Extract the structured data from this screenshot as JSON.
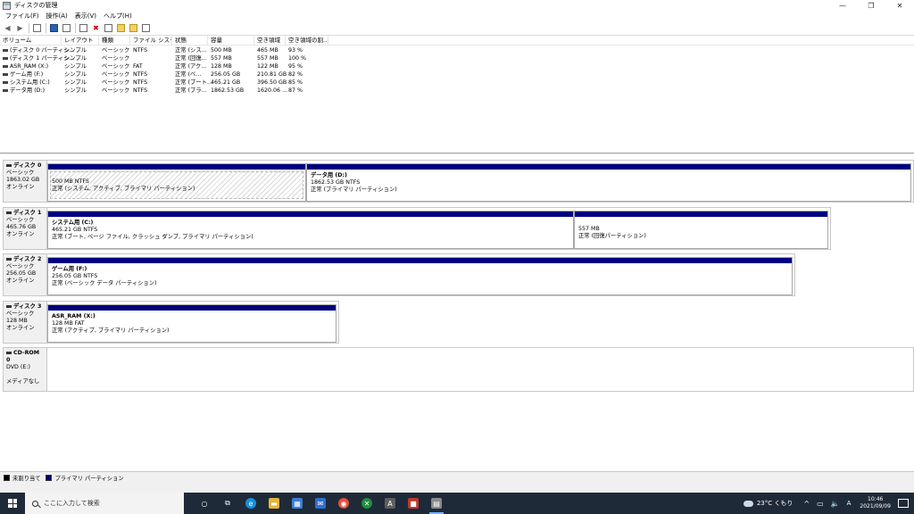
{
  "window": {
    "title": "ディスクの管理",
    "minimize_glyph": "—",
    "restore_glyph": "❐",
    "close_glyph": "✕"
  },
  "menu": [
    "ファイル(F)",
    "操作(A)",
    "表示(V)",
    "ヘルプ(H)"
  ],
  "toolbar": {
    "buttons": [
      "back-icon",
      "forward-icon",
      "view-icon",
      "properties-icon",
      "help-icon",
      "rescan-icon",
      "delete-icon",
      "check-icon",
      "open-icon",
      "new-icon",
      "refresh-icon"
    ],
    "back_glyph": "◀",
    "forward_glyph": "▶",
    "delete_glyph": "✖"
  },
  "volume_list": {
    "columns": [
      "ボリューム",
      "レイアウト",
      "種類",
      "ファイル システム",
      "状態",
      "容量",
      "空き領域",
      "空き領域の割..."
    ],
    "rows": [
      [
        "(ディスク 0 パーティシ...",
        "シンプル",
        "ベーシック",
        "NTFS",
        "正常 (シス...",
        "500 MB",
        "465 MB",
        "93 %"
      ],
      [
        "(ディスク 1 パーティシ...",
        "シンプル",
        "ベーシック",
        "",
        "正常 (回復...",
        "557 MB",
        "557 MB",
        "100 %"
      ],
      [
        "ASR_RAM (X:)",
        "シンプル",
        "ベーシック",
        "FAT",
        "正常 (アク...",
        "128 MB",
        "122 MB",
        "95 %"
      ],
      [
        "ゲーム用 (F:)",
        "シンプル",
        "ベーシック",
        "NTFS",
        "正常 (ベ...",
        "256.05 GB",
        "210.81 GB",
        "82 %"
      ],
      [
        "システム用 (C:)",
        "シンプル",
        "ベーシック",
        "NTFS",
        "正常 (ブート...",
        "465.21 GB",
        "396.50 GB",
        "85 %"
      ],
      [
        "データ用 (D:)",
        "シンプル",
        "ベーシック",
        "NTFS",
        "正常 (プラ...",
        "1862.53 GB",
        "1620.06 ...",
        "87 %"
      ]
    ]
  },
  "disks": [
    {
      "name": "ディスク 0",
      "type": "ベーシック",
      "size": "1863.02 GB",
      "status": "オンライン",
      "partitions": [
        {
          "name": "",
          "size": "500 MB NTFS",
          "status": "正常 (システム, アクティブ, プライマリ パーティション)"
        },
        {
          "name": "データ用 (D:)",
          "size": "1862.53 GB NTFS",
          "status": "正常 (プライマリ パーティション)"
        }
      ]
    },
    {
      "name": "ディスク 1",
      "type": "ベーシック",
      "size": "465.76 GB",
      "status": "オンライン",
      "partitions": [
        {
          "name": "システム用 (C:)",
          "size": "465.21 GB NTFS",
          "status": "正常 (ブート, ページ ファイル, クラッシュ ダンプ, プライマリ パーティション)"
        },
        {
          "name": "",
          "size": "557 MB",
          "status": "正常 (回復パーティション)"
        }
      ]
    },
    {
      "name": "ディスク 2",
      "type": "ベーシック",
      "size": "256.05 GB",
      "status": "オンライン",
      "partitions": [
        {
          "name": "ゲーム用 (F:)",
          "size": "256.05 GB NTFS",
          "status": "正常 (ベーシック データ パーティション)"
        }
      ]
    },
    {
      "name": "ディスク 3",
      "type": "ベーシック",
      "size": "128 MB",
      "status": "オンライン",
      "partitions": [
        {
          "name": "ASR_RAM (X:)",
          "size": "128 MB FAT",
          "status": "正常 (アクティブ, プライマリ パーティション)"
        }
      ]
    },
    {
      "name": "CD-ROM 0",
      "type": "DVD (E:)",
      "size": "",
      "status": "メディアなし",
      "partitions": []
    }
  ],
  "legend": [
    {
      "label": "未割り当て",
      "color": "#000000"
    },
    {
      "label": "プライマリ パーティション",
      "color": "#000080"
    }
  ],
  "taskbar": {
    "search_placeholder": "ここに入力して検索",
    "apps": [
      "cortana-icon",
      "task-view-icon",
      "edge-icon",
      "explorer-icon",
      "store-icon",
      "mail-icon",
      "chrome-icon",
      "xbox-icon",
      "terminal-icon",
      "game-icon",
      "disk-management-icon"
    ],
    "app_glyphs": [
      "○",
      "⧉",
      "e",
      "▬",
      "▦",
      "✉",
      "◉",
      "✕",
      "A",
      "■",
      "▤"
    ],
    "app_colors": [
      "#1f2a38",
      "#1f2a38",
      "#1a8fd6",
      "#e8b339",
      "#3b7dd8",
      "#2f6fcf",
      "#e74c3c",
      "#1e8e3e",
      "#5d5d5d",
      "#c0392b",
      "#8a8a8a"
    ],
    "weather": "23°C くもり",
    "up_glyph": "^",
    "network_glyph": "▭",
    "volume_glyph": "🔈",
    "ime": "A",
    "time": "10:46",
    "date": "2021/09/09"
  }
}
